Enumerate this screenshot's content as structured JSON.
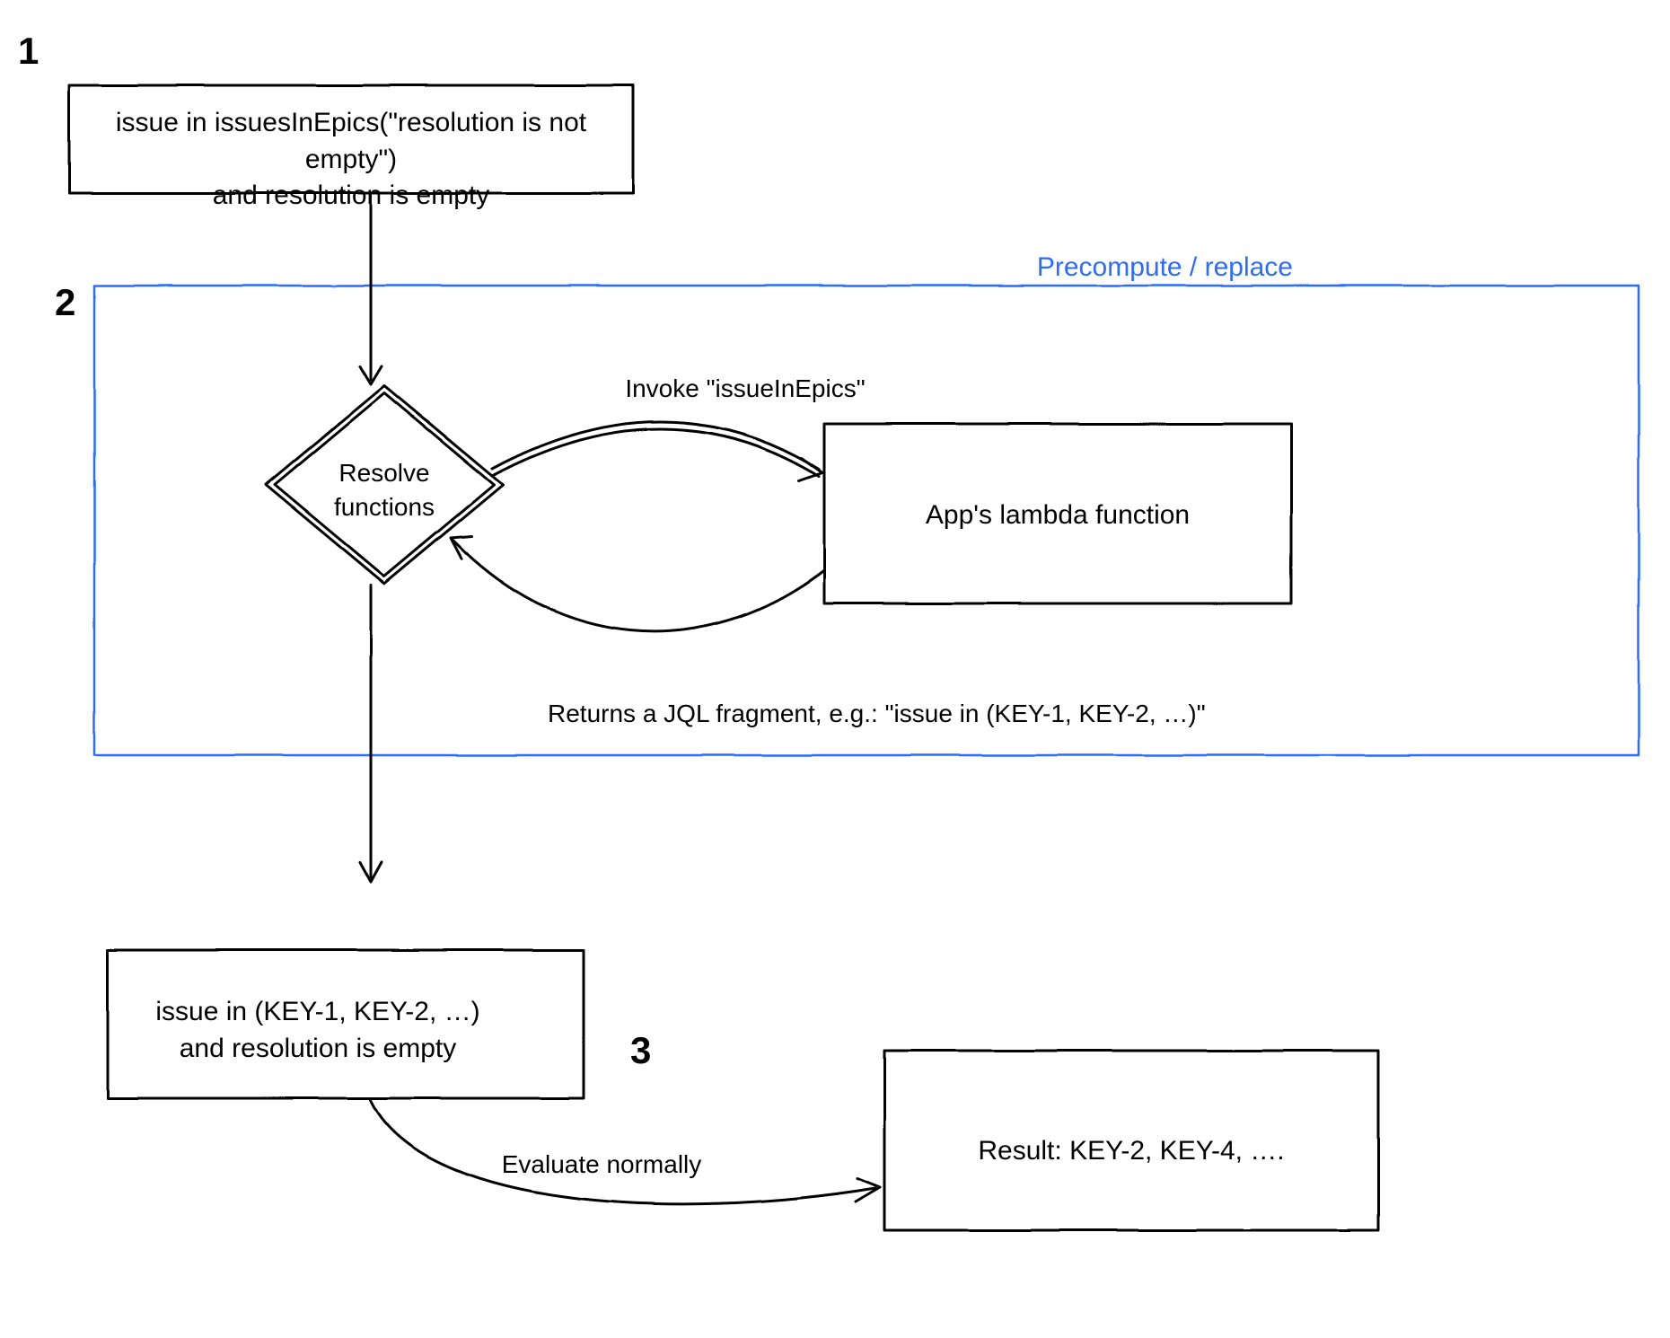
{
  "steps": {
    "one": "1",
    "two": "2",
    "three": "3"
  },
  "group": {
    "title": "Precompute / replace"
  },
  "boxes": {
    "input_query": "issue in issuesInEpics(\"resolution is not empty\")\nand resolution is empty",
    "resolve": "Resolve\nfunctions",
    "lambda": "App's lambda function",
    "rewritten_query": "issue in (KEY-1, KEY-2, …)\nand resolution is empty",
    "result": "Result: KEY-2, KEY-4, …."
  },
  "labels": {
    "invoke": "Invoke \"issueInEpics\"",
    "returns": "Returns a JQL fragment, e.g.: \"issue in (KEY-1, KEY-2, …)\"",
    "evaluate": "Evaluate normally"
  },
  "colors": {
    "ink": "#000000",
    "accent": "#2b6cff",
    "bg": "#ffffff"
  }
}
